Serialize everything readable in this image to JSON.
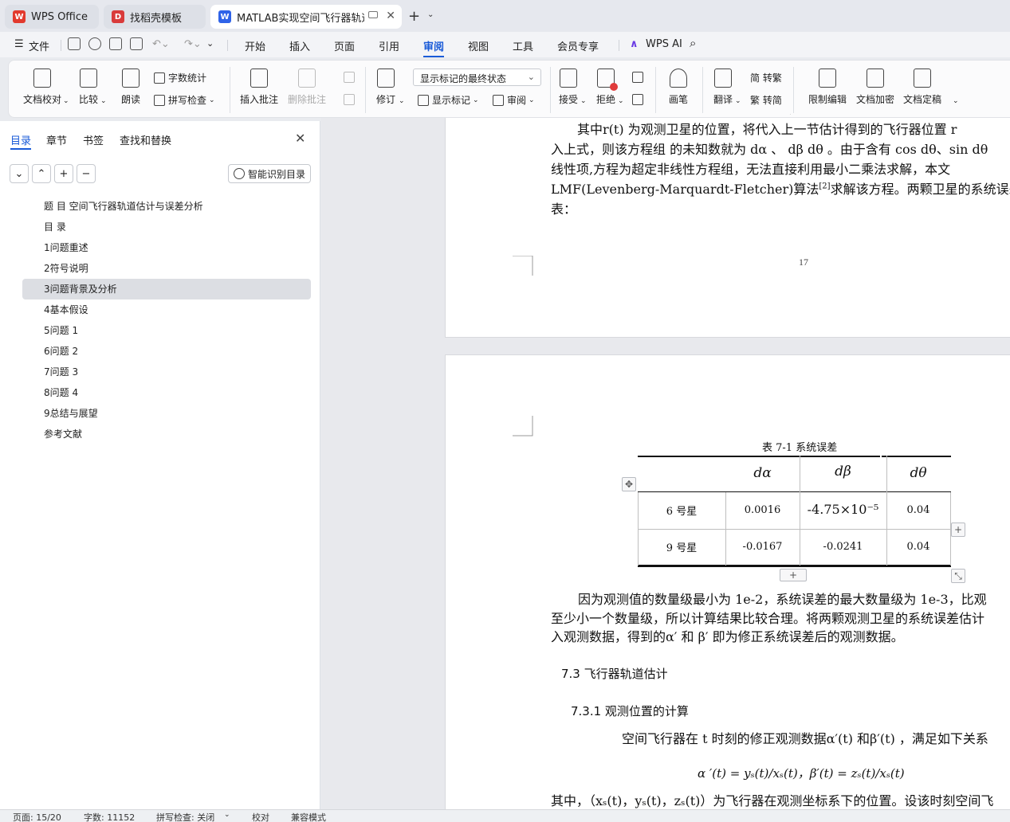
{
  "tabs": [
    {
      "label": "WPS Office",
      "icon": "wps-logo-icon",
      "color": "#e23a2e"
    },
    {
      "label": "找稻壳模板",
      "icon": "docer-icon",
      "color": "#d93b3b"
    },
    {
      "label": "MATLAB实现空间飞行器轨道",
      "icon": "wps-writer-icon",
      "color": "#2f63e8"
    }
  ],
  "menu": {
    "file": "文件",
    "items": [
      "开始",
      "插入",
      "页面",
      "引用",
      "审阅",
      "视图",
      "工具",
      "会员专享"
    ],
    "active": "审阅",
    "ai": "WPS AI"
  },
  "ribbon": {
    "proofread": "文档校对",
    "compare": "比较",
    "read_aloud": "朗读",
    "word_count": "字数统计",
    "spell_check": "拼写检查",
    "insert_comment": "插入批注",
    "delete_comment": "删除批注",
    "track_changes": "修订",
    "markup_select": "显示标记的最终状态",
    "show_markup": "显示标记",
    "review": "审阅",
    "accept": "接受",
    "reject": "拒绝",
    "pen": "画笔",
    "translate": "翻译",
    "to_traditional": "简 转繁",
    "to_simplified": "繁 转简",
    "restrict_edit": "限制编辑",
    "encrypt": "文档加密",
    "finalize": "文档定稿"
  },
  "sidebar": {
    "tabs": [
      "目录",
      "章节",
      "书签",
      "查找和替换"
    ],
    "smart_toc": "智能识别目录",
    "toc": [
      "题 目 空间飞行器轨道估计与误差分析",
      "目 录",
      "1问题重述",
      "2符号说明",
      "3问题背景及分析",
      "4基本假设",
      "5问题 1",
      "6问题 2",
      "7问题 3",
      "8问题 4",
      "9总结与展望",
      "参考文献"
    ],
    "selected_index": 4
  },
  "document": {
    "page1": {
      "line0": "其中r",
      "line0b": "(t) 为观测卫星的位置，将代入上一节估计得到的飞行器位置 r",
      "line1": "入上式，则该方程组 的未知数就为  dα 、 dβ  dθ 。由于含有  cos dθ、sin dθ",
      "line2": "线性项,方程为超定非线性方程组，无法直接利用最小二乘法求解，本文",
      "line3a": "LMF(Levenberg-Marquardt-Fletcher)算法",
      "line3ref": "[2]",
      "line3b": "求解该方程。两颗卫星的系统误差见",
      "line4": "表：",
      "page_number": "17"
    },
    "table": {
      "caption": "表  7-1 系统误差",
      "headers": [
        "",
        "dα",
        "dβ",
        "dθ"
      ],
      "rows": [
        [
          "6 号星",
          "0.0016",
          "-4.75×10⁻⁵",
          "0.04"
        ],
        [
          "9 号星",
          "-0.0167",
          "-0.0241",
          "0.04"
        ]
      ]
    },
    "page2": {
      "para1a": "因为观测值的数量级最小为  1e-2，系统误差的最大数量级为  1e-3，比观",
      "para1b": "至少小一个数量级，所以计算结果比较合理。将两颗观测卫星的系统误差估计",
      "para1c": "入观测数据，得到的α′ 和 β′ 即为修正系统误差后的观测数据。",
      "h_73": "7.3   飞行器轨道估计",
      "h_731": "7.3.1    观测位置的计算",
      "para2": "空间飞行器在  t 时刻的修正观测数据α′(t) 和β′(t) ，满足如下关系",
      "formula": "α ′(t) = yₛ(t)/xₛ(t)，β′(t) = zₛ(t)/xₛ(t)",
      "para3": "其中，（xₛ(t)，yₛ(t)，zₛ(t)）为飞行器在观测坐标系下的位置。设该时刻空间飞"
    }
  },
  "status": {
    "page": "页面: 15/20",
    "words": "字数: 11152",
    "spell": "拼写检查: 关闭",
    "proof": "校对",
    "compat": "兼容模式"
  },
  "colors": {
    "accent": "#1a5bd8",
    "selected_toc": "#dcdee3"
  }
}
